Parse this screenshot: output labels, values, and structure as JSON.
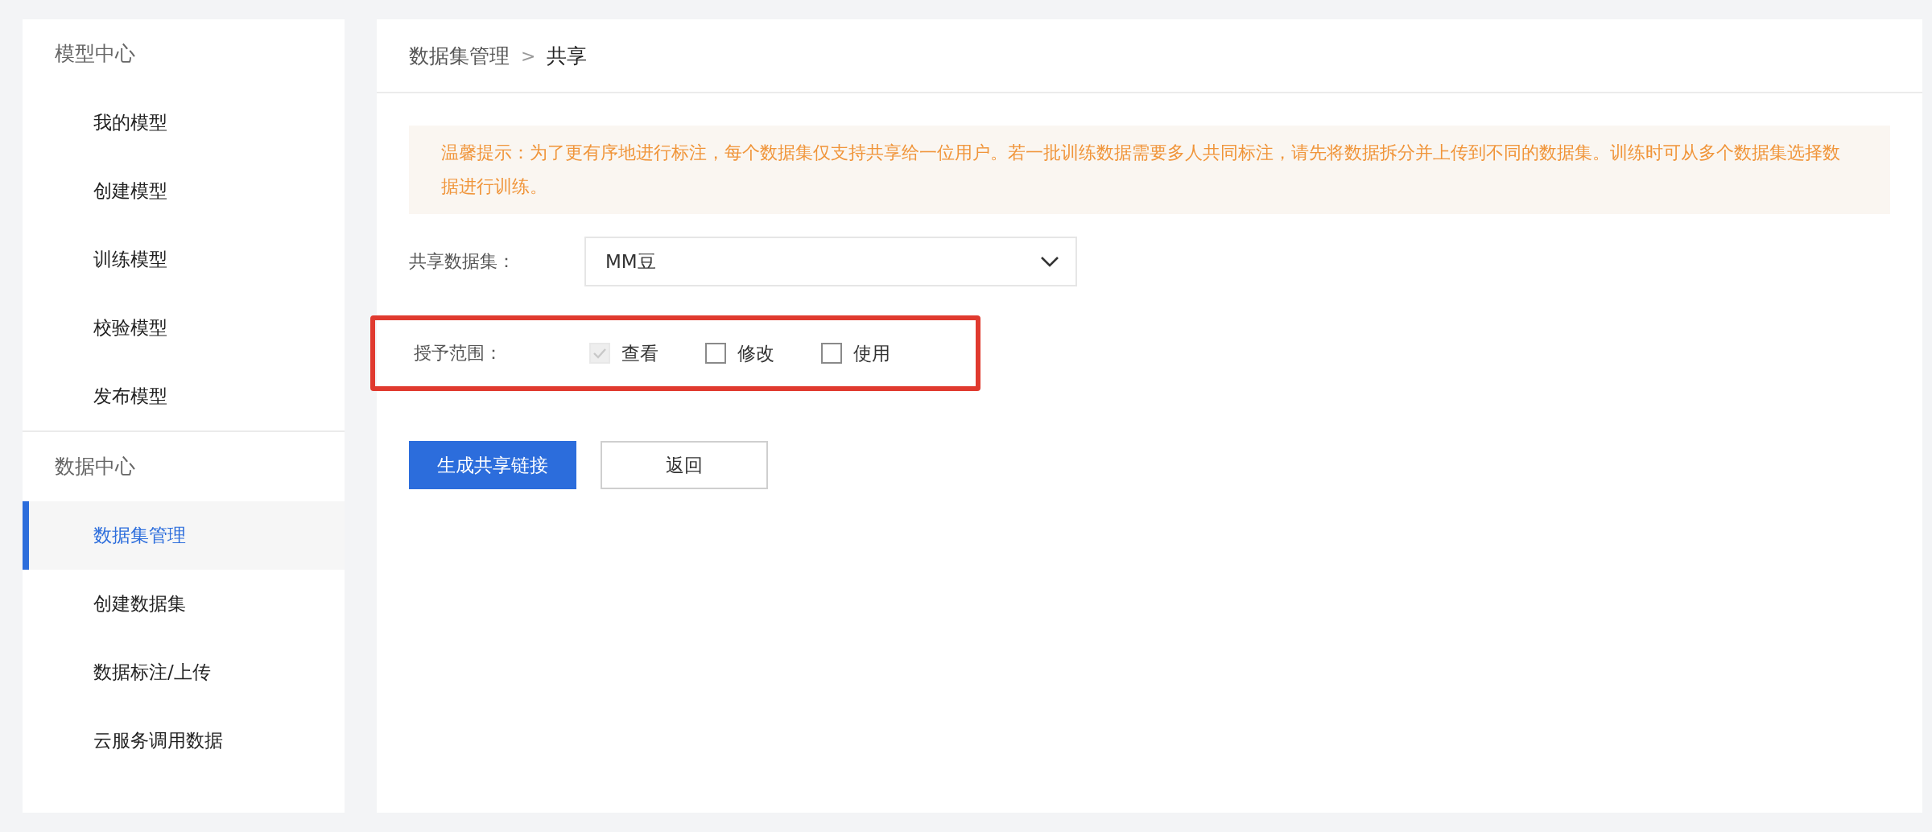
{
  "sidebar": {
    "groups": [
      {
        "title": "模型中心",
        "items": [
          {
            "label": "我的模型",
            "selected": false
          },
          {
            "label": "创建模型",
            "selected": false
          },
          {
            "label": "训练模型",
            "selected": false
          },
          {
            "label": "校验模型",
            "selected": false
          },
          {
            "label": "发布模型",
            "selected": false
          }
        ]
      },
      {
        "title": "数据中心",
        "items": [
          {
            "label": "数据集管理",
            "selected": true
          },
          {
            "label": "创建数据集",
            "selected": false
          },
          {
            "label": "数据标注/上传",
            "selected": false
          },
          {
            "label": "云服务调用数据",
            "selected": false
          }
        ]
      }
    ]
  },
  "breadcrumb": {
    "items": [
      "数据集管理",
      "共享"
    ],
    "separator": ">"
  },
  "notice": "温馨提示：为了更有序地进行标注，每个数据集仅支持共享给一位用户。若一批训练数据需要多人共同标注，请先将数据拆分并上传到不同的数据集。训练时可从多个数据集选择数据进行训练。",
  "form": {
    "dataset": {
      "label": "共享数据集：",
      "value": "MM豆"
    },
    "scope": {
      "label": "授予范围：",
      "highlighted": true,
      "options": [
        {
          "label": "查看",
          "checked": true,
          "disabled": true
        },
        {
          "label": "修改",
          "checked": false,
          "disabled": false
        },
        {
          "label": "使用",
          "checked": false,
          "disabled": false
        }
      ]
    }
  },
  "buttons": [
    {
      "label": "生成共享链接",
      "kind": "primary"
    },
    {
      "label": "返回",
      "kind": "secondary"
    }
  ]
}
